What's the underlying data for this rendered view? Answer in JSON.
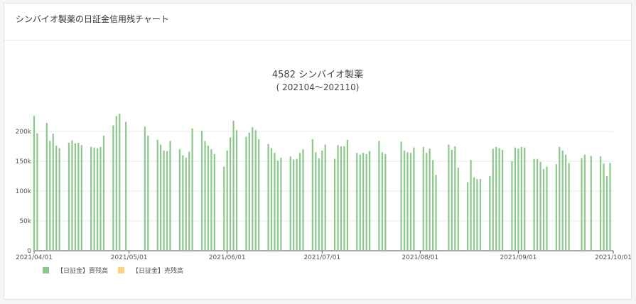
{
  "card": {
    "title": "シンバイオ製薬の日証金信用残チャート"
  },
  "colors": {
    "buy": "#8cc88c",
    "sell": "#ffd27f"
  },
  "chart_data": {
    "type": "bar",
    "title": "4582 シンバイオ製薬",
    "subtitle": "( 202104～202110)",
    "xlabel": "",
    "ylabel": "",
    "ylim": [
      0,
      250000
    ],
    "yticks": [
      0,
      50000,
      100000,
      150000,
      200000
    ],
    "ytick_labels": [
      "0",
      "50k",
      "100k",
      "150k",
      "200k"
    ],
    "xlim": [
      "2021-04-01",
      "2021-10-01"
    ],
    "xticks": [
      "2021-04-01",
      "2021-05-01",
      "2021-06-01",
      "2021-07-01",
      "2021-08-01",
      "2021-09-01",
      "2021-10-01"
    ],
    "xtick_labels": [
      "2021/04/01",
      "2021/05/01",
      "2021/06/01",
      "2021/07/01",
      "2021/08/01",
      "2021/09/01",
      "2021/10/01"
    ],
    "grid": true,
    "legend": "bottom-left",
    "series": [
      {
        "name": "【日証金】買残高",
        "color_key": "buy",
        "x": [
          "2021-04-01",
          "2021-04-02",
          "2021-04-05",
          "2021-04-06",
          "2021-04-07",
          "2021-04-08",
          "2021-04-09",
          "2021-04-12",
          "2021-04-13",
          "2021-04-14",
          "2021-04-15",
          "2021-04-16",
          "2021-04-19",
          "2021-04-20",
          "2021-04-21",
          "2021-04-22",
          "2021-04-23",
          "2021-04-26",
          "2021-04-27",
          "2021-04-28",
          "2021-04-30",
          "2021-05-06",
          "2021-05-07",
          "2021-05-10",
          "2021-05-11",
          "2021-05-12",
          "2021-05-13",
          "2021-05-14",
          "2021-05-17",
          "2021-05-18",
          "2021-05-19",
          "2021-05-20",
          "2021-05-21",
          "2021-05-24",
          "2021-05-25",
          "2021-05-26",
          "2021-05-27",
          "2021-05-28",
          "2021-05-31",
          "2021-06-01",
          "2021-06-02",
          "2021-06-03",
          "2021-06-04",
          "2021-06-07",
          "2021-06-08",
          "2021-06-09",
          "2021-06-10",
          "2021-06-11",
          "2021-06-14",
          "2021-06-15",
          "2021-06-16",
          "2021-06-17",
          "2021-06-18",
          "2021-06-21",
          "2021-06-22",
          "2021-06-23",
          "2021-06-24",
          "2021-06-25",
          "2021-06-28",
          "2021-06-29",
          "2021-06-30",
          "2021-07-01",
          "2021-07-02",
          "2021-07-05",
          "2021-07-06",
          "2021-07-07",
          "2021-07-08",
          "2021-07-09",
          "2021-07-12",
          "2021-07-13",
          "2021-07-14",
          "2021-07-15",
          "2021-07-16",
          "2021-07-19",
          "2021-07-20",
          "2021-07-21",
          "2021-07-26",
          "2021-07-27",
          "2021-07-28",
          "2021-07-29",
          "2021-07-30",
          "2021-08-02",
          "2021-08-03",
          "2021-08-04",
          "2021-08-05",
          "2021-08-06",
          "2021-08-10",
          "2021-08-11",
          "2021-08-12",
          "2021-08-13",
          "2021-08-16",
          "2021-08-17",
          "2021-08-18",
          "2021-08-19",
          "2021-08-20",
          "2021-08-23",
          "2021-08-24",
          "2021-08-25",
          "2021-08-26",
          "2021-08-27",
          "2021-08-30",
          "2021-08-31",
          "2021-09-01",
          "2021-09-02",
          "2021-09-03",
          "2021-09-06",
          "2021-09-07",
          "2021-09-08",
          "2021-09-09",
          "2021-09-10",
          "2021-09-13",
          "2021-09-14",
          "2021-09-15",
          "2021-09-16",
          "2021-09-17",
          "2021-09-21",
          "2021-09-22",
          "2021-09-24",
          "2021-09-27",
          "2021-09-28",
          "2021-09-29",
          "2021-09-30"
        ],
        "values": [
          226000,
          197000,
          214000,
          184000,
          196000,
          176000,
          172000,
          181000,
          185000,
          180000,
          181000,
          177000,
          174000,
          173000,
          172000,
          174000,
          193000,
          210000,
          226000,
          230000,
          216000,
          208000,
          193000,
          186000,
          178000,
          168000,
          167000,
          184000,
          170000,
          160000,
          156000,
          166000,
          205000,
          201000,
          184000,
          176000,
          170000,
          162000,
          141000,
          168000,
          190000,
          218000,
          202000,
          191000,
          198000,
          207000,
          202000,
          187000,
          179000,
          172000,
          164000,
          151000,
          156000,
          158000,
          153000,
          154000,
          164000,
          170000,
          187000,
          165000,
          155000,
          168000,
          178000,
          154000,
          177000,
          175000,
          175000,
          186000,
          164000,
          161000,
          164000,
          162000,
          167000,
          184000,
          165000,
          162000,
          183000,
          168000,
          165000,
          164000,
          173000,
          174000,
          164000,
          171000,
          152000,
          127000,
          178000,
          169000,
          175000,
          139000,
          115000,
          152000,
          123000,
          120000,
          120000,
          125000,
          171000,
          174000,
          172000,
          169000,
          150000,
          173000,
          171000,
          174000,
          173000,
          154000,
          154000,
          149000,
          137000,
          141000,
          145000,
          174000,
          168000,
          161000,
          147000,
          155000,
          161000,
          159000,
          158000,
          146000,
          125000,
          147000
        ],
        "annotation": ""
      },
      {
        "name": "【日証金】売残高",
        "color_key": "sell",
        "x": [],
        "values": []
      }
    ],
    "late_values": {
      "x": [
        "2021-09-30",
        "2021-10-01"
      ],
      "note": ""
    }
  }
}
